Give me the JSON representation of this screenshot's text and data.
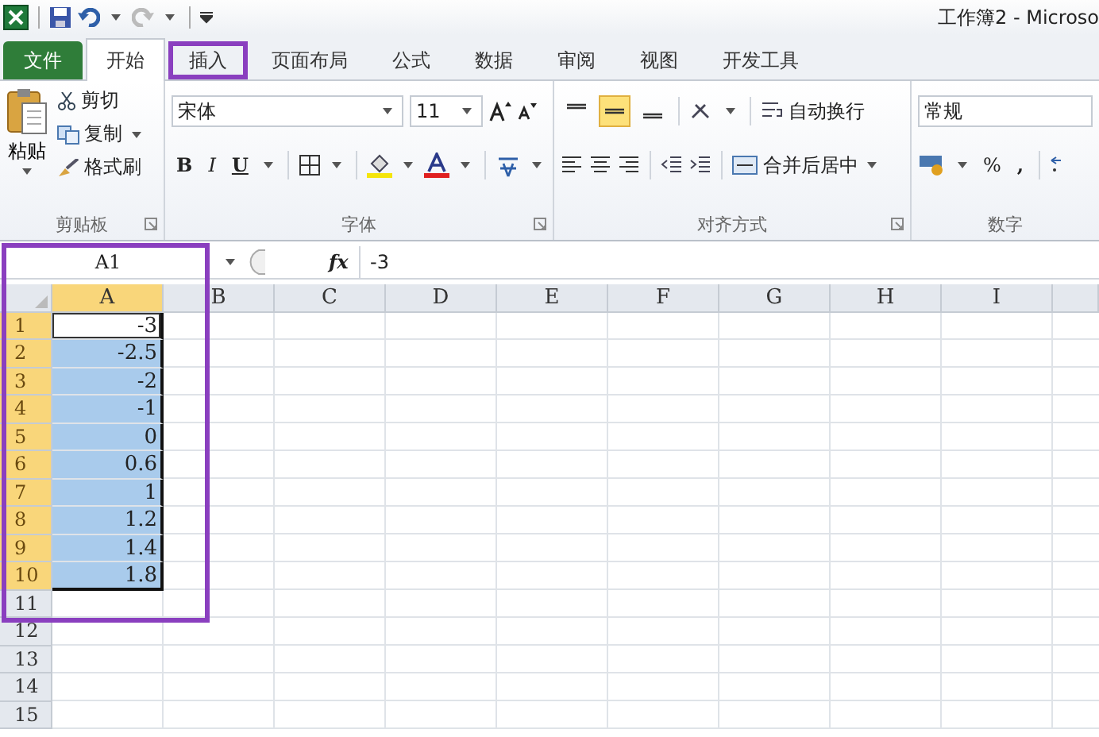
{
  "window": {
    "title": "工作簿2 - Microso"
  },
  "tabs": [
    {
      "label": "文件",
      "kind": "file",
      "selected": false,
      "highlighted": false
    },
    {
      "label": "开始",
      "kind": "tab",
      "selected": true,
      "highlighted": false
    },
    {
      "label": "插入",
      "kind": "tab",
      "selected": false,
      "highlighted": true
    },
    {
      "label": "页面布局",
      "kind": "tab",
      "selected": false,
      "highlighted": false
    },
    {
      "label": "公式",
      "kind": "tab",
      "selected": false,
      "highlighted": false
    },
    {
      "label": "数据",
      "kind": "tab",
      "selected": false,
      "highlighted": false
    },
    {
      "label": "审阅",
      "kind": "tab",
      "selected": false,
      "highlighted": false
    },
    {
      "label": "视图",
      "kind": "tab",
      "selected": false,
      "highlighted": false
    },
    {
      "label": "开发工具",
      "kind": "tab",
      "selected": false,
      "highlighted": false
    }
  ],
  "clipboard": {
    "paste": "粘贴",
    "cut": "剪切",
    "copy": "复制",
    "format_painter": "格式刷",
    "label": "剪贴板"
  },
  "font": {
    "name": "宋体",
    "size": "11",
    "bold": "B",
    "italic": "I",
    "underline": "U",
    "label": "字体"
  },
  "alignment": {
    "vertical": [
      {
        "selected": false
      },
      {
        "selected": true
      },
      {
        "selected": false
      }
    ],
    "wrap": "自动换行",
    "merge": "合并后居中",
    "label": "对齐方式"
  },
  "number": {
    "format": "常规",
    "percent": "%",
    "comma": ",",
    "label": "数字"
  },
  "formula_bar": {
    "name_box": "A1",
    "function_label": "fx",
    "value": "-3"
  },
  "sheet": {
    "highlight_frame": true,
    "columns": [
      {
        "label": "A",
        "selected": true
      },
      {
        "label": "B",
        "selected": false
      },
      {
        "label": "C",
        "selected": false
      },
      {
        "label": "D",
        "selected": false
      },
      {
        "label": "E",
        "selected": false
      },
      {
        "label": "F",
        "selected": false
      },
      {
        "label": "G",
        "selected": false
      },
      {
        "label": "H",
        "selected": false
      },
      {
        "label": "I",
        "selected": false
      }
    ],
    "rows": [
      {
        "label": "1",
        "selected": true,
        "cell": {
          "value": "-3",
          "active": true
        }
      },
      {
        "label": "2",
        "selected": true,
        "cell": {
          "value": "-2.5",
          "active": false
        }
      },
      {
        "label": "3",
        "selected": true,
        "cell": {
          "value": "-2",
          "active": false
        }
      },
      {
        "label": "4",
        "selected": true,
        "cell": {
          "value": "-1",
          "active": false
        }
      },
      {
        "label": "5",
        "selected": true,
        "cell": {
          "value": "0",
          "active": false
        }
      },
      {
        "label": "6",
        "selected": true,
        "cell": {
          "value": "0.6",
          "active": false
        }
      },
      {
        "label": "7",
        "selected": true,
        "cell": {
          "value": "1",
          "active": false
        }
      },
      {
        "label": "8",
        "selected": true,
        "cell": {
          "value": "1.2",
          "active": false
        }
      },
      {
        "label": "9",
        "selected": true,
        "cell": {
          "value": "1.4",
          "active": false
        }
      },
      {
        "label": "10",
        "selected": true,
        "cell": {
          "value": "1.8",
          "active": false
        }
      },
      {
        "label": "11",
        "selected": false
      },
      {
        "label": "12",
        "selected": false
      },
      {
        "label": "13",
        "selected": false
      },
      {
        "label": "14",
        "selected": false
      },
      {
        "label": "15",
        "selected": false
      }
    ]
  }
}
